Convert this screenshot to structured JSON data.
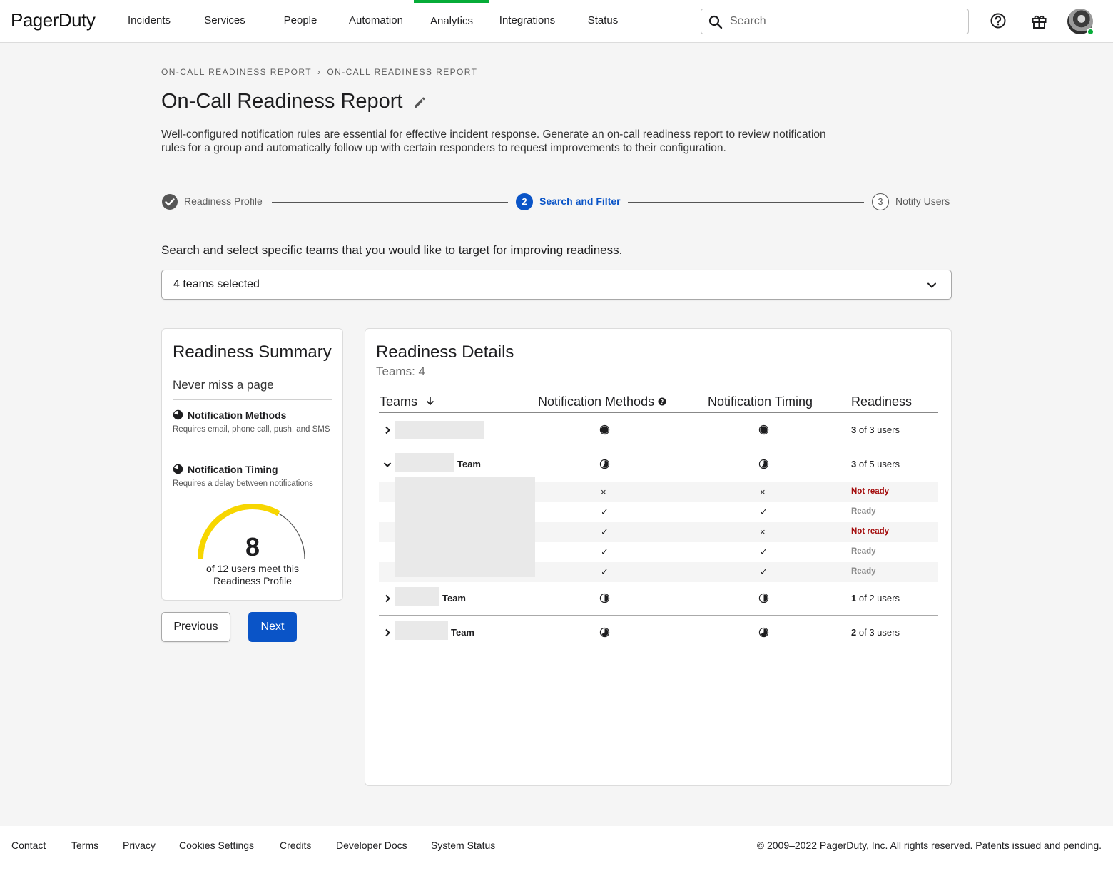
{
  "nav": {
    "logo": "PagerDuty",
    "items": [
      "Incidents",
      "Services",
      "People",
      "Automation",
      "Analytics",
      "Integrations",
      "Status"
    ],
    "active": "Analytics",
    "search_placeholder": "Search",
    "accent_color": "#06ac38"
  },
  "breadcrumb": [
    "ON-CALL READINESS REPORT",
    "ON-CALL READINESS REPORT"
  ],
  "page": {
    "title": "On-Call Readiness Report",
    "description": "Well-configured notification rules are essential for effective incident response. Generate an on-call readiness report to review notification rules for a group and automatically follow up with certain responders to request improvements to their configuration."
  },
  "stepper": {
    "steps": [
      {
        "number": "1",
        "label": "Readiness Profile",
        "state": "complete"
      },
      {
        "number": "2",
        "label": "Search and Filter",
        "state": "active"
      },
      {
        "number": "3",
        "label": "Notify Users",
        "state": "upcoming"
      }
    ],
    "active_color": "#0a54c7"
  },
  "filter": {
    "prompt": "Search and select specific teams that you would like to target for improving readiness.",
    "selected_value": "4 teams selected"
  },
  "summary": {
    "title": "Readiness Summary",
    "subtitle": "Never miss a page",
    "requirements": [
      {
        "name": "Notification Methods",
        "text": "Requires email, phone call, push, and SMS"
      },
      {
        "name": "Notification Timing",
        "text": "Requires a delay between notifications"
      }
    ],
    "gauge": {
      "value": "8",
      "caption": "of 12 users meet this Readiness Profile",
      "met": 8,
      "total": 12,
      "color": "#f7d600"
    }
  },
  "buttons": {
    "previous": "Previous",
    "next": "Next"
  },
  "details": {
    "title": "Readiness Details",
    "teams_count": "Teams: 4",
    "columns": [
      "Teams",
      "Notification Methods",
      "Notification Timing",
      "Readiness"
    ],
    "rows": [
      {
        "label": "",
        "expanded": false,
        "methods": 1.0,
        "timing": 1.0,
        "ready": "3",
        "of_text": "of 3 users"
      },
      {
        "label": "Team",
        "expanded": true,
        "methods": 0.6,
        "timing": 0.6,
        "ready": "3",
        "of_text": "of 5 users",
        "members": [
          {
            "methods": "×",
            "timing": "×",
            "status": "Not ready"
          },
          {
            "methods": "✓",
            "timing": "✓",
            "status": "Ready"
          },
          {
            "methods": "✓",
            "timing": "×",
            "status": "Not ready"
          },
          {
            "methods": "✓",
            "timing": "✓",
            "status": "Ready"
          },
          {
            "methods": "✓",
            "timing": "✓",
            "status": "Ready"
          }
        ]
      },
      {
        "label": "Team",
        "expanded": false,
        "methods": 0.5,
        "timing": 0.5,
        "ready": "1",
        "of_text": "of 2 users"
      },
      {
        "label": "Team",
        "expanded": false,
        "methods": 0.667,
        "timing": 0.667,
        "ready": "2",
        "of_text": "of 3 users"
      }
    ]
  },
  "footer": {
    "links": [
      "Contact",
      "Terms",
      "Privacy",
      "Cookies Settings",
      "Credits",
      "Developer Docs",
      "System Status"
    ],
    "copyright": "© 2009–2022 PagerDuty, Inc. All rights reserved. Patents issued and pending."
  }
}
